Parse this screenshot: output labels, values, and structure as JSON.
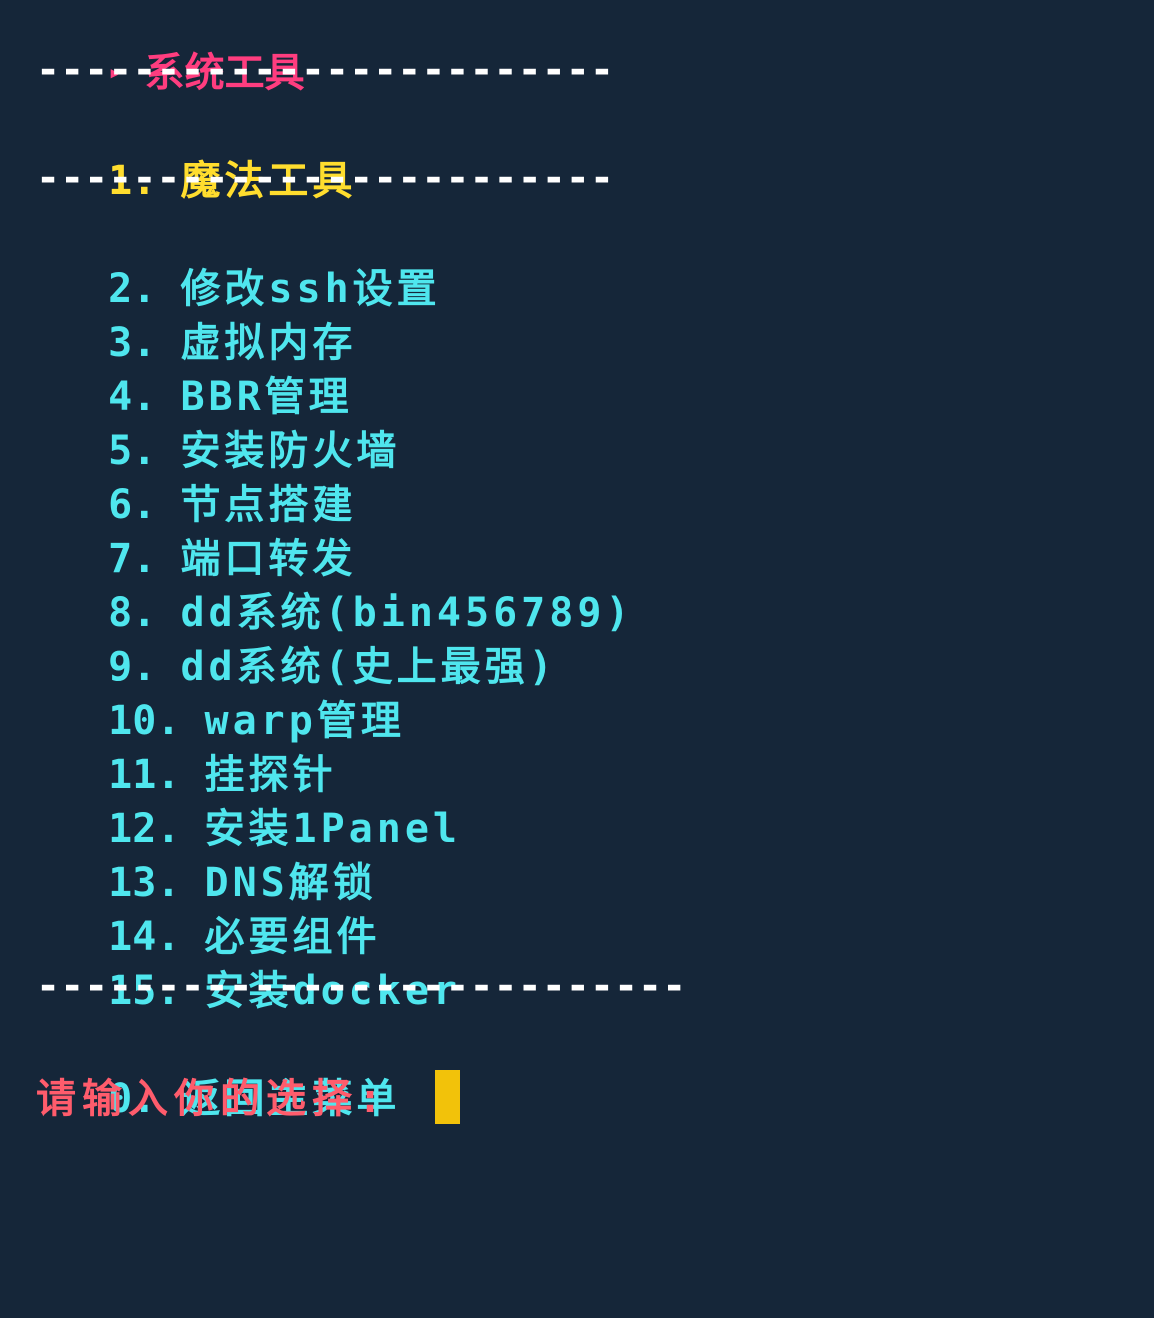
{
  "header": {
    "arrow": "▸",
    "title": "系统工具"
  },
  "separators": {
    "short": "------------------------",
    "long": "---------------------------"
  },
  "items": [
    {
      "num": "1.",
      "label": "魔法工具"
    },
    {
      "num": "2.",
      "label": "修改ssh设置"
    },
    {
      "num": "3.",
      "label": "虚拟内存"
    },
    {
      "num": "4.",
      "label": "BBR管理"
    },
    {
      "num": "5.",
      "label": "安装防火墙"
    },
    {
      "num": "6.",
      "label": "节点搭建"
    },
    {
      "num": "7.",
      "label": "端口转发"
    },
    {
      "num": "8.",
      "label": "dd系统(bin456789)"
    },
    {
      "num": "9.",
      "label": "dd系统(史上最强)"
    },
    {
      "num": "10.",
      "label": "warp管理"
    },
    {
      "num": "11.",
      "label": "挂探针"
    },
    {
      "num": "12.",
      "label": "安装1Panel"
    },
    {
      "num": "13.",
      "label": "DNS解锁"
    },
    {
      "num": "14.",
      "label": "必要组件"
    },
    {
      "num": "15.",
      "label": "安装docker"
    }
  ],
  "back": {
    "num": "0.",
    "label": "返回主菜单"
  },
  "prompt": "请输入你的选择:",
  "colors": {
    "background": "#152639",
    "header": "#ff3d7f",
    "highlight": "#ffdd2e",
    "item": "#4fe6ee",
    "prompt": "#ff5c6c",
    "cursor": "#f2c20a"
  }
}
